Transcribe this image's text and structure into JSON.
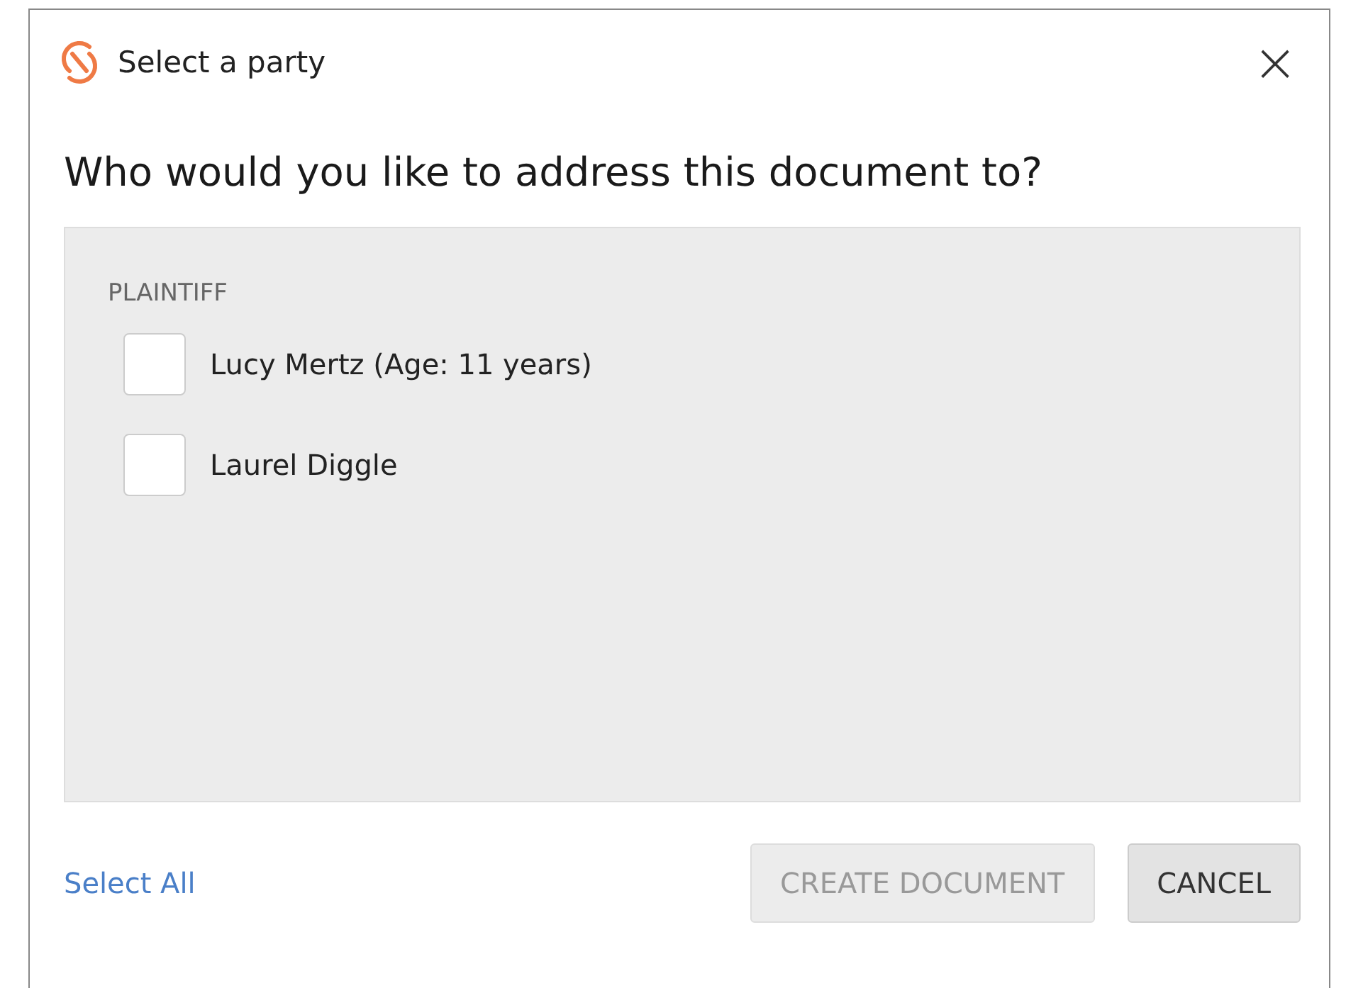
{
  "window": {
    "title": "Select a party",
    "close": "×"
  },
  "heading": "Who would you like to address this document to?",
  "group": {
    "label": "PLAINTIFF",
    "parties": [
      {
        "name": "Lucy Mertz (Age: 11 years)",
        "checked": false
      },
      {
        "name": "Laurel Diggle",
        "checked": false
      }
    ]
  },
  "select_all": "Select All",
  "buttons": [
    {
      "label": "CREATE DOCUMENT",
      "disabled": true
    },
    {
      "label": "CANCEL",
      "disabled": false
    }
  ]
}
